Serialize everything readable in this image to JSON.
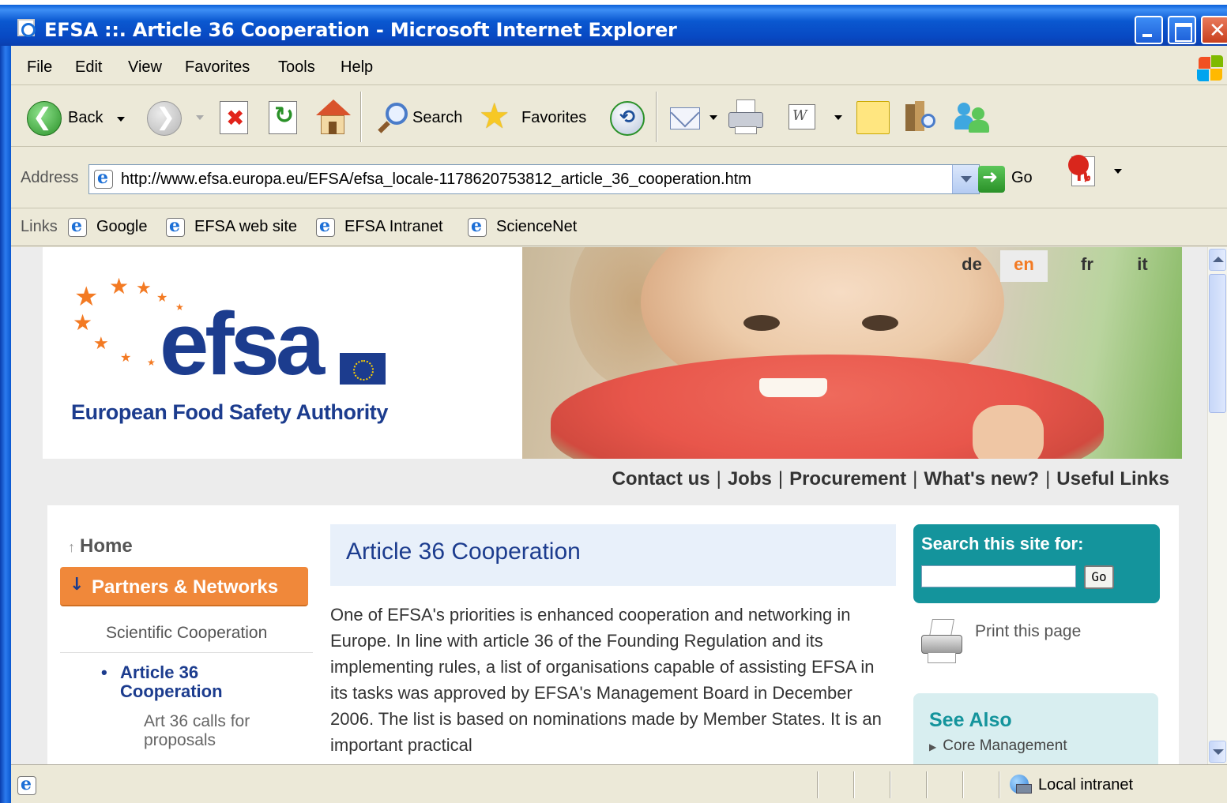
{
  "window": {
    "title": "EFSA ::. Article 36 Cooperation - Microsoft Internet Explorer"
  },
  "menu": {
    "items": [
      "File",
      "Edit",
      "View",
      "Favorites",
      "Tools",
      "Help"
    ]
  },
  "toolbar": {
    "back_label": "Back",
    "search_label": "Search",
    "favorites_label": "Favorites"
  },
  "address": {
    "label": "Address",
    "url": "http://www.efsa.europa.eu/EFSA/efsa_locale-1178620753812_article_36_cooperation.htm",
    "go_label": "Go"
  },
  "links": {
    "label": "Links",
    "items": [
      "Google",
      "EFSA web site",
      "EFSA Intranet",
      "ScienceNet"
    ]
  },
  "site": {
    "logo_text": "efsa",
    "logo_subtitle": "European Food Safety Authority",
    "languages": [
      {
        "code": "de",
        "active": false
      },
      {
        "code": "en",
        "active": true
      },
      {
        "code": "fr",
        "active": false
      },
      {
        "code": "it",
        "active": false
      }
    ],
    "utility_links": [
      "Contact us",
      "Jobs",
      "Procurement",
      "What's new?",
      "Useful Links"
    ],
    "nav": {
      "home": "Home",
      "active_section": "Partners & Networks",
      "sub_item": "Scientific Cooperation",
      "current": "Article 36 Cooperation",
      "leaf": "Art 36 calls for proposals"
    },
    "main": {
      "title": "Article 36 Cooperation",
      "body": "One of EFSA's priorities is enhanced cooperation and networking in Europe. In line with article 36 of the Founding Regulation and its implementing rules, a list of organisations capable of assisting EFSA in its tasks was approved by EFSA's Management Board in December 2006. The list is based on nominations made by Member States. It is an important practical"
    },
    "search": {
      "label": "Search this site for:",
      "value": "",
      "go_label": "Go"
    },
    "print_label": "Print this page",
    "see_also": {
      "title": "See Also",
      "items": [
        "Core Management"
      ]
    }
  },
  "status": {
    "zone": "Local intranet"
  },
  "colors": {
    "efsa_blue": "#1c3c8e",
    "efsa_orange": "#f37a23",
    "teal": "#14949c",
    "xp_blue": "#0a58d0"
  }
}
